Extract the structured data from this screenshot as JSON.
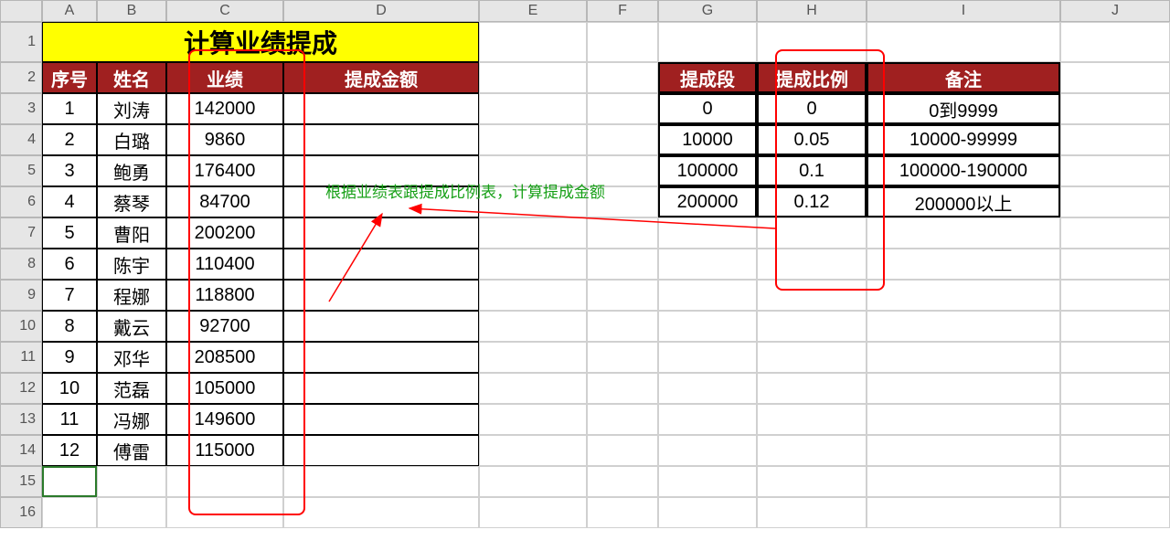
{
  "columns": [
    "A",
    "B",
    "C",
    "D",
    "E",
    "F",
    "G",
    "H",
    "I",
    "J"
  ],
  "row_numbers": [
    1,
    2,
    3,
    4,
    5,
    6,
    7,
    8,
    9,
    10,
    11,
    12,
    13,
    14,
    15,
    16
  ],
  "title": "计算业绩提成",
  "main_table": {
    "headers": {
      "seq": "序号",
      "name": "姓名",
      "perf": "业绩",
      "commission": "提成金额"
    },
    "rows": [
      {
        "seq": 1,
        "name": "刘涛",
        "perf": "142000",
        "comm": ""
      },
      {
        "seq": 2,
        "name": "白璐",
        "perf": "9860",
        "comm": ""
      },
      {
        "seq": 3,
        "name": "鲍勇",
        "perf": "176400",
        "comm": ""
      },
      {
        "seq": 4,
        "name": "蔡琴",
        "perf": "84700",
        "comm": ""
      },
      {
        "seq": 5,
        "name": "曹阳",
        "perf": "200200",
        "comm": ""
      },
      {
        "seq": 6,
        "name": "陈宇",
        "perf": "110400",
        "comm": ""
      },
      {
        "seq": 7,
        "name": "程娜",
        "perf": "118800",
        "comm": ""
      },
      {
        "seq": 8,
        "name": "戴云",
        "perf": "92700",
        "comm": ""
      },
      {
        "seq": 9,
        "name": "邓华",
        "perf": "208500",
        "comm": ""
      },
      {
        "seq": 10,
        "name": "范磊",
        "perf": "105000",
        "comm": ""
      },
      {
        "seq": 11,
        "name": "冯娜",
        "perf": "149600",
        "comm": ""
      },
      {
        "seq": 12,
        "name": "傅雷",
        "perf": "115000",
        "comm": ""
      }
    ]
  },
  "rate_table": {
    "headers": {
      "tier": "提成段",
      "ratio": "提成比例",
      "note": "备注"
    },
    "rows": [
      {
        "tier": "0",
        "ratio": "0",
        "note": "0到9999"
      },
      {
        "tier": "10000",
        "ratio": "0.05",
        "note": "10000-99999"
      },
      {
        "tier": "100000",
        "ratio": "0.1",
        "note": "100000-190000"
      },
      {
        "tier": "200000",
        "ratio": "0.12",
        "note": "200000以上"
      }
    ]
  },
  "annotation": "根据业绩表跟提成比例表，计算提成金额",
  "active_cell": "A15"
}
